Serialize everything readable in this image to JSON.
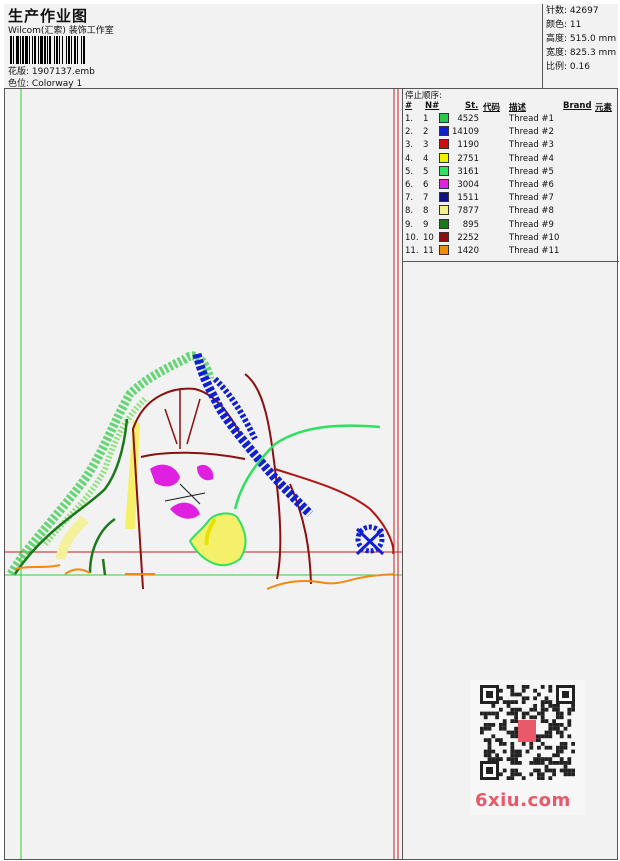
{
  "header": {
    "title": "生产作业图",
    "company": "Wilcom(汇索) 装饰工作室",
    "design_label": "花版:",
    "design_value": "1907137.emb",
    "colorway_label": "色位:",
    "colorway_value": "Colorway 1"
  },
  "specs": [
    {
      "label": "针数:",
      "value": "42697"
    },
    {
      "label": "颜色:",
      "value": "11"
    },
    {
      "label": "高度:",
      "value": "515.0 mm"
    },
    {
      "label": "宽度:",
      "value": "825.3 mm"
    },
    {
      "label": "比例:",
      "value": "0.16"
    }
  ],
  "stop_sequence": {
    "caption": "停止顺序:",
    "columns": [
      "#",
      "N#",
      "St.",
      "代码",
      "描述",
      "Brand",
      "元素"
    ],
    "rows": [
      {
        "idx": "1.",
        "n": "1",
        "color": "#22cc44",
        "st": "4525",
        "desc": "Thread #1"
      },
      {
        "idx": "2.",
        "n": "2",
        "color": "#1020d0",
        "st": "14109",
        "desc": "Thread #2"
      },
      {
        "idx": "3.",
        "n": "3",
        "color": "#cc1010",
        "st": "1190",
        "desc": "Thread #3"
      },
      {
        "idx": "4.",
        "n": "4",
        "color": "#f5f000",
        "st": "2751",
        "desc": "Thread #4"
      },
      {
        "idx": "5.",
        "n": "5",
        "color": "#30e060",
        "st": "3161",
        "desc": "Thread #5"
      },
      {
        "idx": "6.",
        "n": "6",
        "color": "#e020e0",
        "st": "3004",
        "desc": "Thread #6"
      },
      {
        "idx": "7.",
        "n": "7",
        "color": "#101080",
        "st": "1511",
        "desc": "Thread #7"
      },
      {
        "idx": "8.",
        "n": "8",
        "color": "#f5f090",
        "st": "7877",
        "desc": "Thread #8"
      },
      {
        "idx": "9.",
        "n": "9",
        "color": "#1a7a1a",
        "st": "895",
        "desc": "Thread #9"
      },
      {
        "idx": "10.",
        "n": "10",
        "color": "#8b1010",
        "st": "2252",
        "desc": "Thread #10"
      },
      {
        "idx": "11.",
        "n": "11",
        "color": "#f08a10",
        "st": "1420",
        "desc": "Thread #11"
      }
    ]
  },
  "watermark": {
    "text": "6xiu.com"
  }
}
